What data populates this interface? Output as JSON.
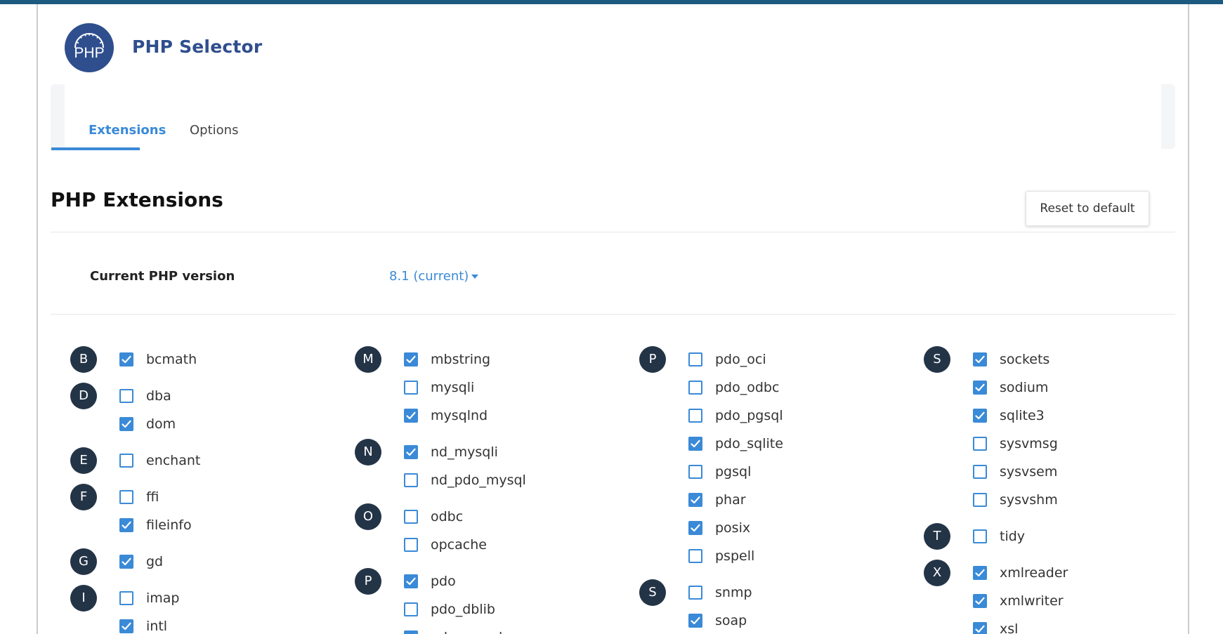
{
  "header": {
    "logo_text": "PHP",
    "title": "PHP Selector"
  },
  "tabs": [
    {
      "label": "Extensions",
      "active": true
    },
    {
      "label": "Options",
      "active": false
    }
  ],
  "section": {
    "title": "PHP Extensions",
    "reset_label": "Reset to default"
  },
  "version": {
    "label": "Current PHP version",
    "value": "8.1 (current)"
  },
  "colors": {
    "accent": "#3a8ad7",
    "brand": "#2f4e8d",
    "badge": "#243447",
    "topbar": "#1d5a80"
  },
  "columns": [
    [
      {
        "letter": "B",
        "items": [
          {
            "name": "bcmath",
            "checked": true
          }
        ]
      },
      {
        "letter": "D",
        "items": [
          {
            "name": "dba",
            "checked": false
          },
          {
            "name": "dom",
            "checked": true
          }
        ]
      },
      {
        "letter": "E",
        "items": [
          {
            "name": "enchant",
            "checked": false
          }
        ]
      },
      {
        "letter": "F",
        "items": [
          {
            "name": "ffi",
            "checked": false
          },
          {
            "name": "fileinfo",
            "checked": true
          }
        ]
      },
      {
        "letter": "G",
        "items": [
          {
            "name": "gd",
            "checked": true
          }
        ]
      },
      {
        "letter": "I",
        "items": [
          {
            "name": "imap",
            "checked": false
          },
          {
            "name": "intl",
            "checked": true
          }
        ]
      }
    ],
    [
      {
        "letter": "M",
        "items": [
          {
            "name": "mbstring",
            "checked": true
          },
          {
            "name": "mysqli",
            "checked": false
          },
          {
            "name": "mysqlnd",
            "checked": true
          }
        ]
      },
      {
        "letter": "N",
        "items": [
          {
            "name": "nd_mysqli",
            "checked": true
          },
          {
            "name": "nd_pdo_mysql",
            "checked": false
          }
        ]
      },
      {
        "letter": "O",
        "items": [
          {
            "name": "odbc",
            "checked": false
          },
          {
            "name": "opcache",
            "checked": false
          }
        ]
      },
      {
        "letter": "P",
        "items": [
          {
            "name": "pdo",
            "checked": true
          },
          {
            "name": "pdo_dblib",
            "checked": false
          },
          {
            "name": "pdo_mysql",
            "checked": true
          }
        ]
      }
    ],
    [
      {
        "letter": "P",
        "items": [
          {
            "name": "pdo_oci",
            "checked": false
          },
          {
            "name": "pdo_odbc",
            "checked": false
          },
          {
            "name": "pdo_pgsql",
            "checked": false
          },
          {
            "name": "pdo_sqlite",
            "checked": true
          },
          {
            "name": "pgsql",
            "checked": false
          },
          {
            "name": "phar",
            "checked": true
          },
          {
            "name": "posix",
            "checked": true
          },
          {
            "name": "pspell",
            "checked": false
          }
        ]
      },
      {
        "letter": "S",
        "items": [
          {
            "name": "snmp",
            "checked": false
          },
          {
            "name": "soap",
            "checked": true
          }
        ]
      }
    ],
    [
      {
        "letter": "S",
        "items": [
          {
            "name": "sockets",
            "checked": true
          },
          {
            "name": "sodium",
            "checked": true
          },
          {
            "name": "sqlite3",
            "checked": true
          },
          {
            "name": "sysvmsg",
            "checked": false
          },
          {
            "name": "sysvsem",
            "checked": false
          },
          {
            "name": "sysvshm",
            "checked": false
          }
        ]
      },
      {
        "letter": "T",
        "items": [
          {
            "name": "tidy",
            "checked": false
          }
        ]
      },
      {
        "letter": "X",
        "items": [
          {
            "name": "xmlreader",
            "checked": true
          },
          {
            "name": "xmlwriter",
            "checked": true
          },
          {
            "name": "xsl",
            "checked": true
          }
        ]
      }
    ]
  ]
}
